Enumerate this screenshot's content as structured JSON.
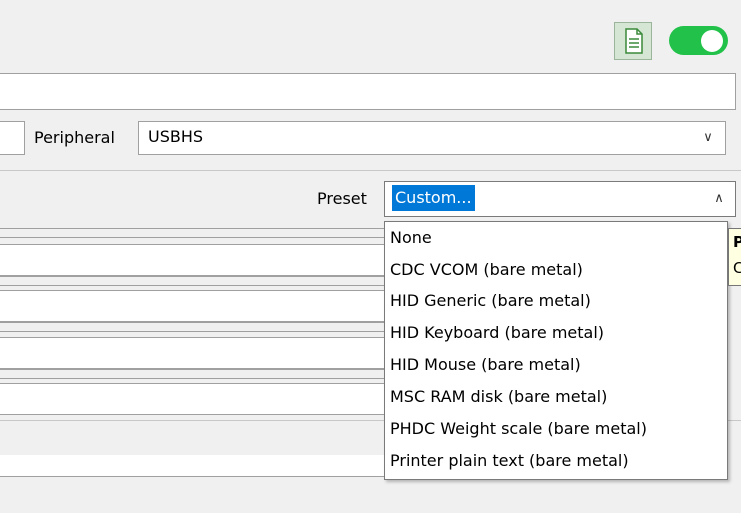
{
  "toolbar": {
    "doc_icon": "document-icon",
    "toggle_on": true,
    "toggle_color": "#22c24a"
  },
  "name_field": {
    "value": ""
  },
  "peripheral": {
    "label": "Peripheral",
    "value": "USBHS"
  },
  "preset": {
    "label": "Preset",
    "value": "Custom...",
    "options": [
      "None",
      "CDC VCOM (bare metal)",
      "HID Generic (bare metal)",
      "HID Keyboard (bare metal)",
      "HID Mouse (bare metal)",
      "MSC RAM disk (bare metal)",
      "PHDC Weight scale (bare metal)",
      "Printer plain text (bare metal)"
    ]
  },
  "tooltip": {
    "line1": "P",
    "line2": "C"
  },
  "colors": {
    "selection": "#0078d7",
    "tooltip_bg": "#ffffe1"
  }
}
